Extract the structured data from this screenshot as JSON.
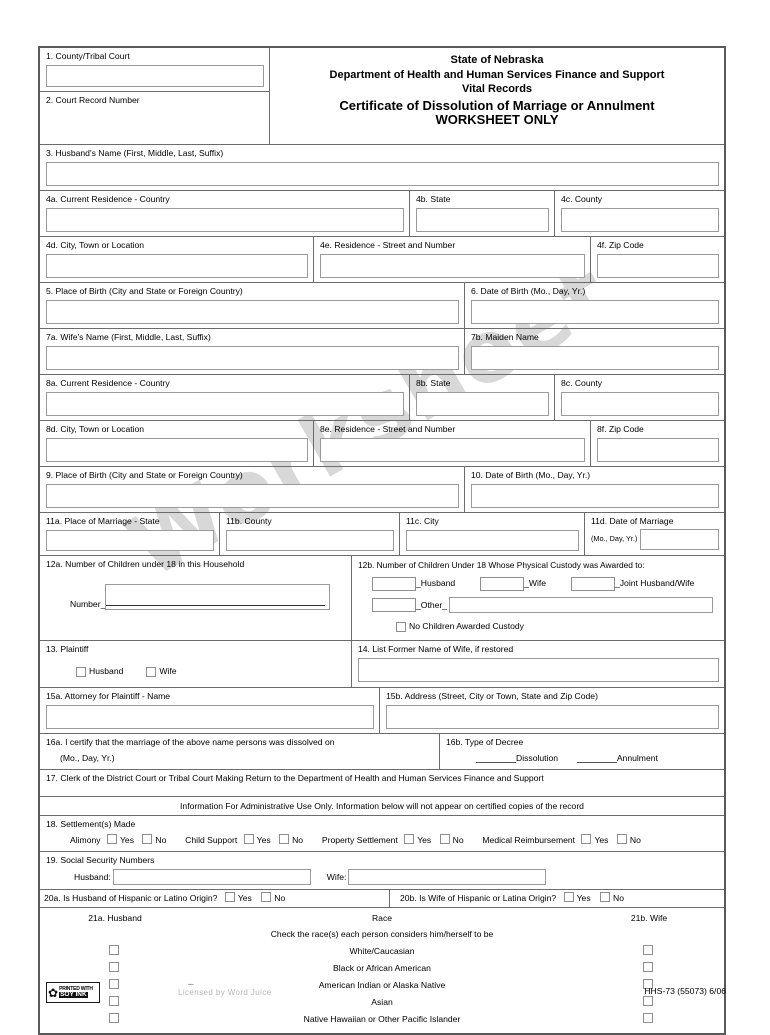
{
  "watermark": "Worksheet",
  "header": {
    "line1": "State of Nebraska",
    "line2": "Department of Health and Human Services Finance and Support",
    "line3": "Vital Records",
    "line4": "Certificate of Dissolution of Marriage or Annulment",
    "line5": "WORKSHEET ONLY"
  },
  "fields": {
    "f1": "1.  County/Tribal Court",
    "f2": "2.  Court Record Number",
    "f3": "3.  Husband's Name (First, Middle, Last, Suffix)",
    "f4a": "4a.  Current Residence - Country",
    "f4b": "4b.  State",
    "f4c": "4c.  County",
    "f4d": "4d. City, Town or Location",
    "f4e": "4e.  Residence - Street and Number",
    "f4f": "4f.  Zip Code",
    "f5": "5.  Place of Birth (City and State or Foreign Country)",
    "f6": "6.  Date of Birth (Mo., Day, Yr.)",
    "f7a": "7a.  Wife's Name (First, Middle, Last, Suffix)",
    "f7b": "7b.  Maiden Name",
    "f8a": "8a.  Current Residence - Country",
    "f8b": "8b.  State",
    "f8c": "8c.  County",
    "f8d": "8d. City, Town or Location",
    "f8e": "8e.  Residence - Street and Number",
    "f8f": "8f.  Zip Code",
    "f9": "9.  Place of Birth (City and State or Foreign Country)",
    "f10": "10.  Date of Birth (Mo., Day, Yr.)",
    "f11a": "11a.  Place of Marriage - State",
    "f11b": "11b.  County",
    "f11c": "11c.  City",
    "f11d": "11d.  Date of Marriage",
    "f11d_sub": "(Mo., Day, Yr.)",
    "f12a": "12a.  Number of Children under 18 in this Household",
    "f12a_number": "Number",
    "f12b": "12b.  Number of Children Under 18 Whose Physical Custody was Awarded to:",
    "f12b_husband": "Husband",
    "f12b_wife": "Wife",
    "f12b_joint": "Joint Husband/Wife",
    "f12b_other": "Other",
    "f12b_none": "No Children Awarded Custody",
    "f13": "13.  Plaintiff",
    "f13_husband": "Husband",
    "f13_wife": "Wife",
    "f14": "14.  List Former Name of Wife, if restored",
    "f15a": "15a.  Attorney for Plaintiff - Name",
    "f15b": "15b.  Address (Street, City or Town, State and Zip Code)",
    "f16a": "16a.  I certify that the marriage of the above name persons was dissolved on",
    "f16a_sub": "(Mo., Day, Yr.)",
    "f16b": "16b.  Type of Decree",
    "f16b_dissolution": "Dissolution",
    "f16b_annulment": "Annulment",
    "f17": "17.  Clerk of the District Court or Tribal Court Making Return to the Department of Health and Human Services Finance and Support",
    "admin_notice": "Information For Administrative Use Only. Information below will not appear on certified copies of the record",
    "f18": "18.  Settlement(s) Made",
    "f18_alimony": "Alimony",
    "f18_child_support": "Child Support",
    "f18_property": "Property Settlement",
    "f18_medical": "Medical Reimbursement",
    "yes": "Yes",
    "no": "No",
    "f19": "19.  Social Security Numbers",
    "f19_husband": "Husband:",
    "f19_wife": "Wife:",
    "f20a": "20a.  Is Husband of Hispanic or Latino Origin?",
    "f20b": "20b.  Is Wife of Hispanic or Latina Origin?",
    "f21a": "21a. Husband",
    "f21_race": "Race",
    "f21b": "21b. Wife",
    "f21_instruction": "Check the race(s) each person considers him/herself to be"
  },
  "races": [
    "White/Caucasian",
    "Black or African American",
    "American Indian or Alaska Native",
    "Asian",
    "Native Hawaiian or Other Pacific Islander"
  ],
  "footer": {
    "soy_line1": "PRINTED WITH",
    "soy_line2": "SOY INK",
    "faded_text": "Licensed by Word Juice",
    "form_code": "HHS-73 (55073) 6/06"
  }
}
